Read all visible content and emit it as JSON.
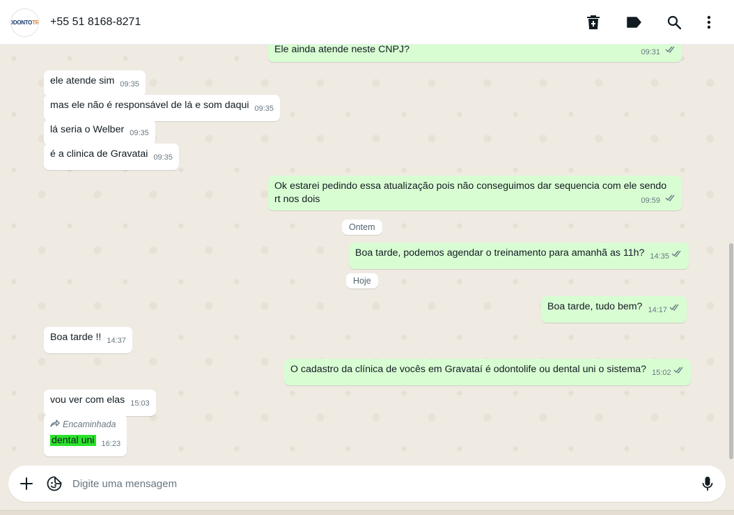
{
  "header": {
    "avatar_text_a": "ODONTO",
    "avatar_text_b": "TRI",
    "contact_name": "+55 51 8168-8271"
  },
  "messages": [
    {
      "dir": "out",
      "text": "Ele ainda atende neste CNPJ?",
      "time": "09:31"
    },
    {
      "dir": "in",
      "text": "ele atende sim",
      "time": "09:35"
    },
    {
      "dir": "in",
      "text": "mas ele não é responsável de lá e som daqui",
      "time": "09:35"
    },
    {
      "dir": "in",
      "text": "lá seria o Welber",
      "time": "09:35"
    },
    {
      "dir": "in",
      "text": "é a clinica de Gravatai",
      "time": "09:35"
    },
    {
      "dir": "out",
      "text": "Ok estarei pedindo essa atualização pois não conseguimos dar sequencia com ele sendo rt nos dois",
      "time": "09:59"
    },
    {
      "dir": "out",
      "text": "Boa tarde, podemos agendar o treinamento para amanhã as 11h?",
      "time": "14:35"
    },
    {
      "dir": "out",
      "text": "Boa tarde, tudo bem?",
      "time": "14:17"
    },
    {
      "dir": "in",
      "text": "Boa tarde !!",
      "time": "14:37"
    },
    {
      "dir": "out",
      "text": "O cadastro da clínica de vocês em Gravataí é odontolife ou dental uni o sistema?",
      "time": "15:02"
    },
    {
      "dir": "in",
      "text": "vou ver com elas",
      "time": "15:03"
    },
    {
      "dir": "in",
      "forwarded_label": "Encaminhada",
      "text": "dental uni",
      "time": "16:23"
    }
  ],
  "day_chips": {
    "yesterday": "Ontem",
    "today": "Hoje"
  },
  "composer": {
    "placeholder": "Digite uma mensagem"
  },
  "colors": {
    "incoming_bubble": "#ffffff",
    "outgoing_bubble": "#d9fdd3",
    "chat_background": "#efeae2",
    "highlight": "#2be22b"
  },
  "icons": [
    "delete-icon",
    "label-icon",
    "search-icon",
    "menu-dots-icon",
    "plus-icon",
    "sticker-icon",
    "mic-icon",
    "double-check-icon",
    "forward-icon"
  ]
}
